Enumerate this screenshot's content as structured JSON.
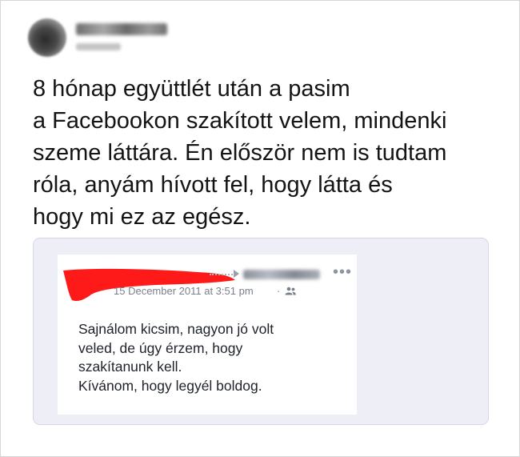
{
  "post": {
    "lines": [
      "8 hónap együttlét után a pasim",
      "a Facebookon szakított velem, mindenki",
      "szeme láttára. Én először nem is tudtam",
      "róla, anyám hívott fel, hogy látta és",
      "hogy mi ez az egész."
    ]
  },
  "embed": {
    "more_glyph": "•••",
    "date": "15 December 2011 at 3:51 pm",
    "separator": "·",
    "audience_icon": "friends-icon",
    "message_lines": [
      "Sajnálom kicsim, nagyon jó volt",
      "veled, de úgy érzem, hogy",
      "szakítanunk kell.",
      "Kívánom, hogy legyél boldog."
    ]
  },
  "colors": {
    "redaction": "#ff1a1a",
    "embed_background": "#eeeef7",
    "meta_text": "#7a808a"
  }
}
